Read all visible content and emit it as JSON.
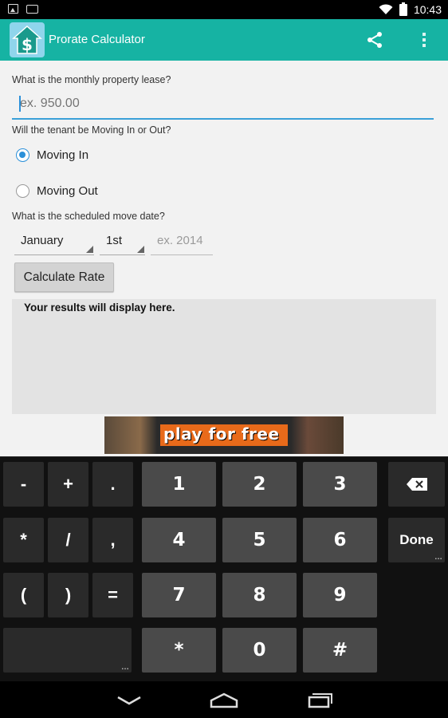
{
  "status_bar": {
    "time": "10:43"
  },
  "app": {
    "title": "Prorate Calculator",
    "accent_color": "#16b3a3"
  },
  "form": {
    "lease_question": "What is the monthly property lease?",
    "lease_placeholder": "ex. 950.00",
    "moving_question": "Will the tenant be Moving In or Out?",
    "options": [
      {
        "label": "Moving In",
        "checked": true
      },
      {
        "label": "Moving Out",
        "checked": false
      }
    ],
    "date_question": "What is the scheduled move date?",
    "month_value": "January",
    "day_value": "1st",
    "year_placeholder": "ex. 2014",
    "calculate_label": "Calculate Rate",
    "results_text": "Your results will display here."
  },
  "ad": {
    "text": "play for free"
  },
  "keyboard": {
    "rows": [
      [
        "-",
        "+",
        ".",
        "1",
        "2",
        "3",
        "backspace-icon"
      ],
      [
        "*",
        "/",
        ",",
        "4",
        "5",
        "6",
        "Done"
      ],
      [
        "(",
        ")",
        "=",
        "7",
        "8",
        "9"
      ],
      [
        "space",
        "*",
        "0",
        "#"
      ]
    ],
    "done_label": "Done"
  }
}
